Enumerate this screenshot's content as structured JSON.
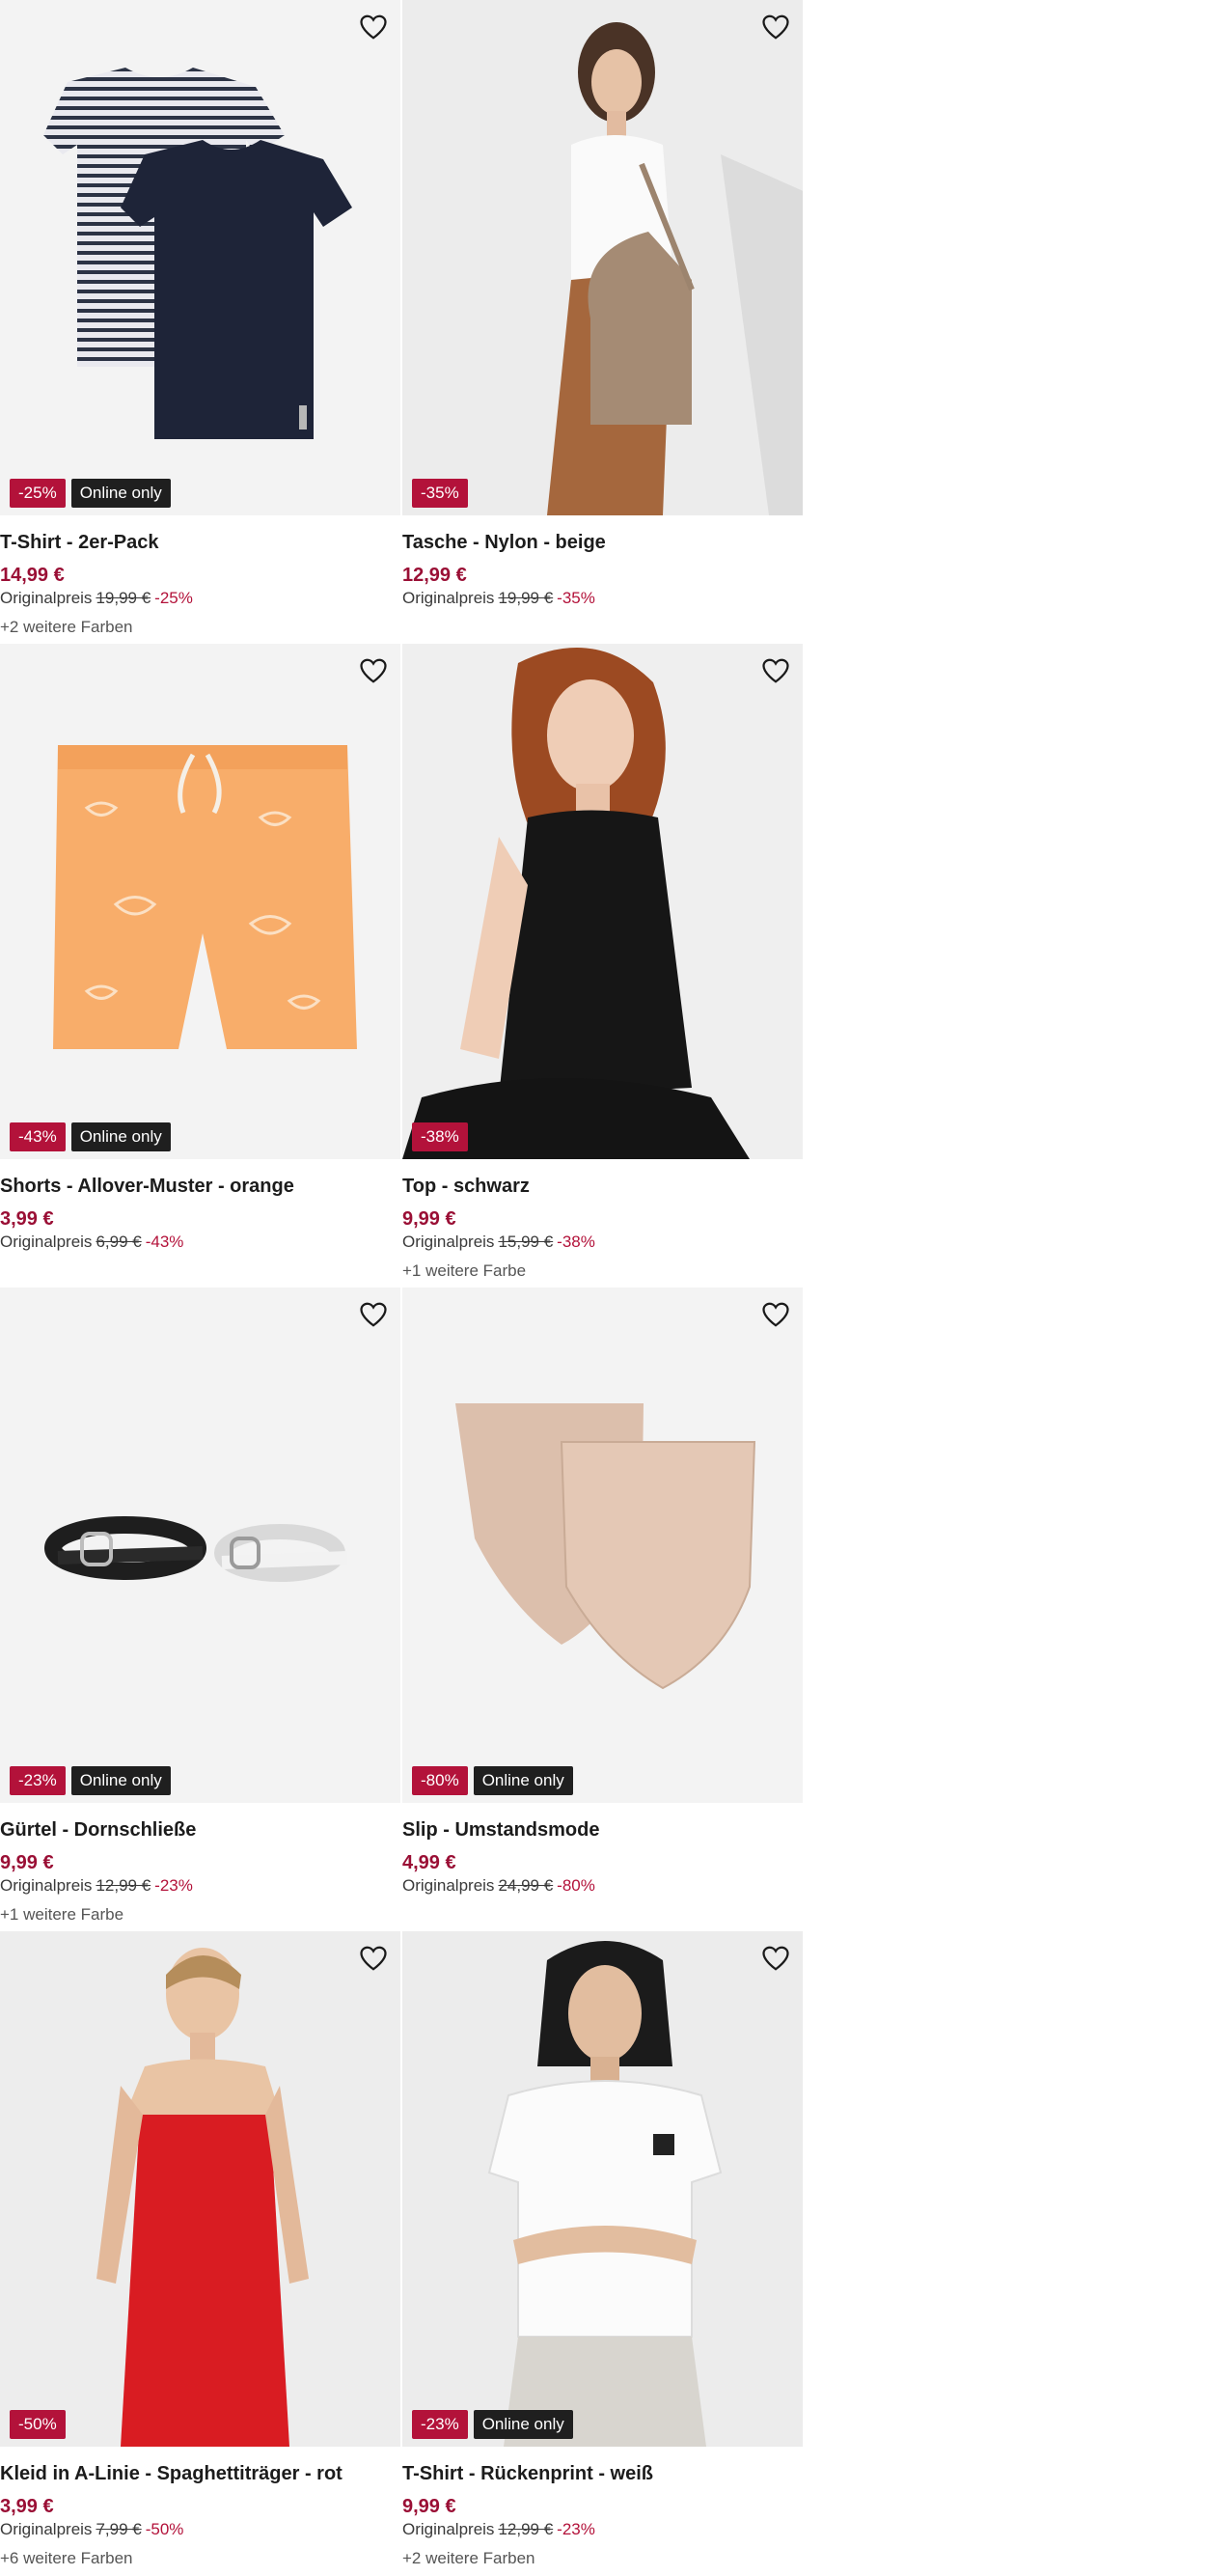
{
  "products": [
    {
      "title": "T-Shirt - 2er-Pack",
      "price": "14,99 €",
      "orig_label": "Originalpreis",
      "orig_price": "19,99 €",
      "orig_pct": "-25%",
      "badge_discount": "-25%",
      "badge_online": "Online only",
      "colors": "+2 weitere Farben",
      "image_icon": "striped-tshirts-image"
    },
    {
      "title": "Tasche - Nylon - beige",
      "price": "12,99 €",
      "orig_label": "Originalpreis",
      "orig_price": "19,99 €",
      "orig_pct": "-35%",
      "badge_discount": "-35%",
      "badge_online": "",
      "colors": "",
      "image_icon": "model-with-bag-image"
    },
    {
      "title": "Shorts - Allover-Muster - orange",
      "price": "3,99 €",
      "orig_label": "Originalpreis",
      "orig_price": "6,99 €",
      "orig_pct": "-43%",
      "badge_discount": "-43%",
      "badge_online": "Online only",
      "colors": "",
      "image_icon": "orange-shorts-image"
    },
    {
      "title": "Top - schwarz",
      "price": "9,99 €",
      "orig_label": "Originalpreis",
      "orig_price": "15,99 €",
      "orig_pct": "-38%",
      "badge_discount": "-38%",
      "badge_online": "",
      "colors": "+1 weitere Farbe",
      "image_icon": "model-black-top-image"
    },
    {
      "title": "Gürtel - Dornschließe",
      "price": "9,99 €",
      "orig_label": "Originalpreis",
      "orig_price": "12,99 €",
      "orig_pct": "-23%",
      "badge_discount": "-23%",
      "badge_online": "Online only",
      "colors": "+1 weitere Farbe",
      "image_icon": "belts-image"
    },
    {
      "title": "Slip - Umstandsmode",
      "price": "4,99 €",
      "orig_label": "Originalpreis",
      "orig_price": "24,99 €",
      "orig_pct": "-80%",
      "badge_discount": "-80%",
      "badge_online": "Online only",
      "colors": "",
      "image_icon": "maternity-briefs-image"
    },
    {
      "title": "Kleid in A-Linie - Spaghettiträger - rot",
      "price": "3,99 €",
      "orig_label": "Originalpreis",
      "orig_price": "7,99 €",
      "orig_pct": "-50%",
      "badge_discount": "-50%",
      "badge_online": "",
      "colors": "+6 weitere Farben",
      "image_icon": "model-red-dress-image"
    },
    {
      "title": "T-Shirt - Rückenprint - weiß",
      "price": "9,99 €",
      "orig_label": "Originalpreis",
      "orig_price": "12,99 €",
      "orig_pct": "-23%",
      "badge_discount": "-23%",
      "badge_online": "Online only",
      "colors": "+2 weitere Farben",
      "image_icon": "model-white-tshirt-image"
    }
  ],
  "icons": {
    "favorite": "heart-outline-icon"
  },
  "colors": {
    "price": "#9a0f35",
    "discount_badge": "#b3123a",
    "online_badge": "#1f1f1f",
    "image_bg": "#f3f3f3"
  }
}
